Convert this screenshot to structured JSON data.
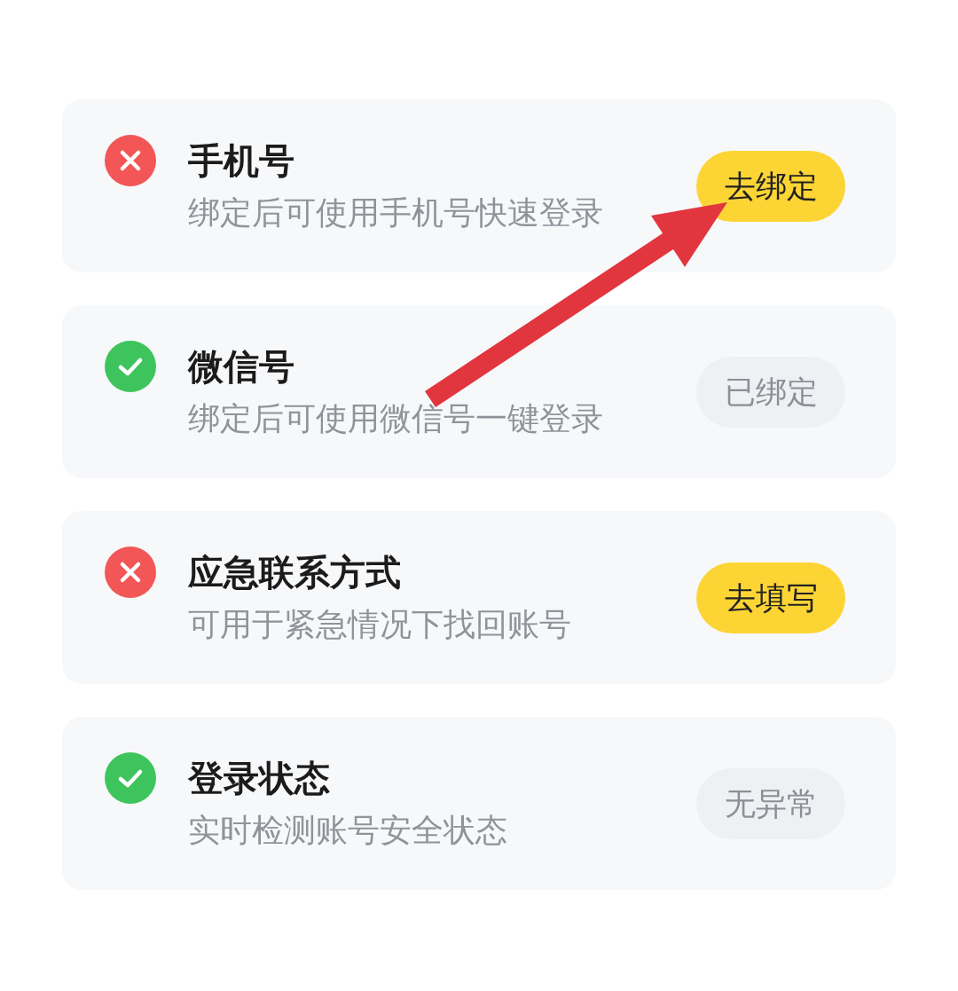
{
  "items": [
    {
      "title": "手机号",
      "subtitle": "绑定后可使用手机号快速登录",
      "ok": false,
      "action": {
        "label": "去绑定",
        "kind": "primary"
      }
    },
    {
      "title": "微信号",
      "subtitle": "绑定后可使用微信号一键登录",
      "ok": true,
      "action": {
        "label": "已绑定",
        "kind": "done"
      }
    },
    {
      "title": "应急联系方式",
      "subtitle": "可用于紧急情况下找回账号",
      "ok": false,
      "action": {
        "label": "去填写",
        "kind": "primary"
      }
    },
    {
      "title": "登录状态",
      "subtitle": "实时检测账号安全状态",
      "ok": true,
      "action": {
        "label": "无异常",
        "kind": "done"
      }
    }
  ]
}
